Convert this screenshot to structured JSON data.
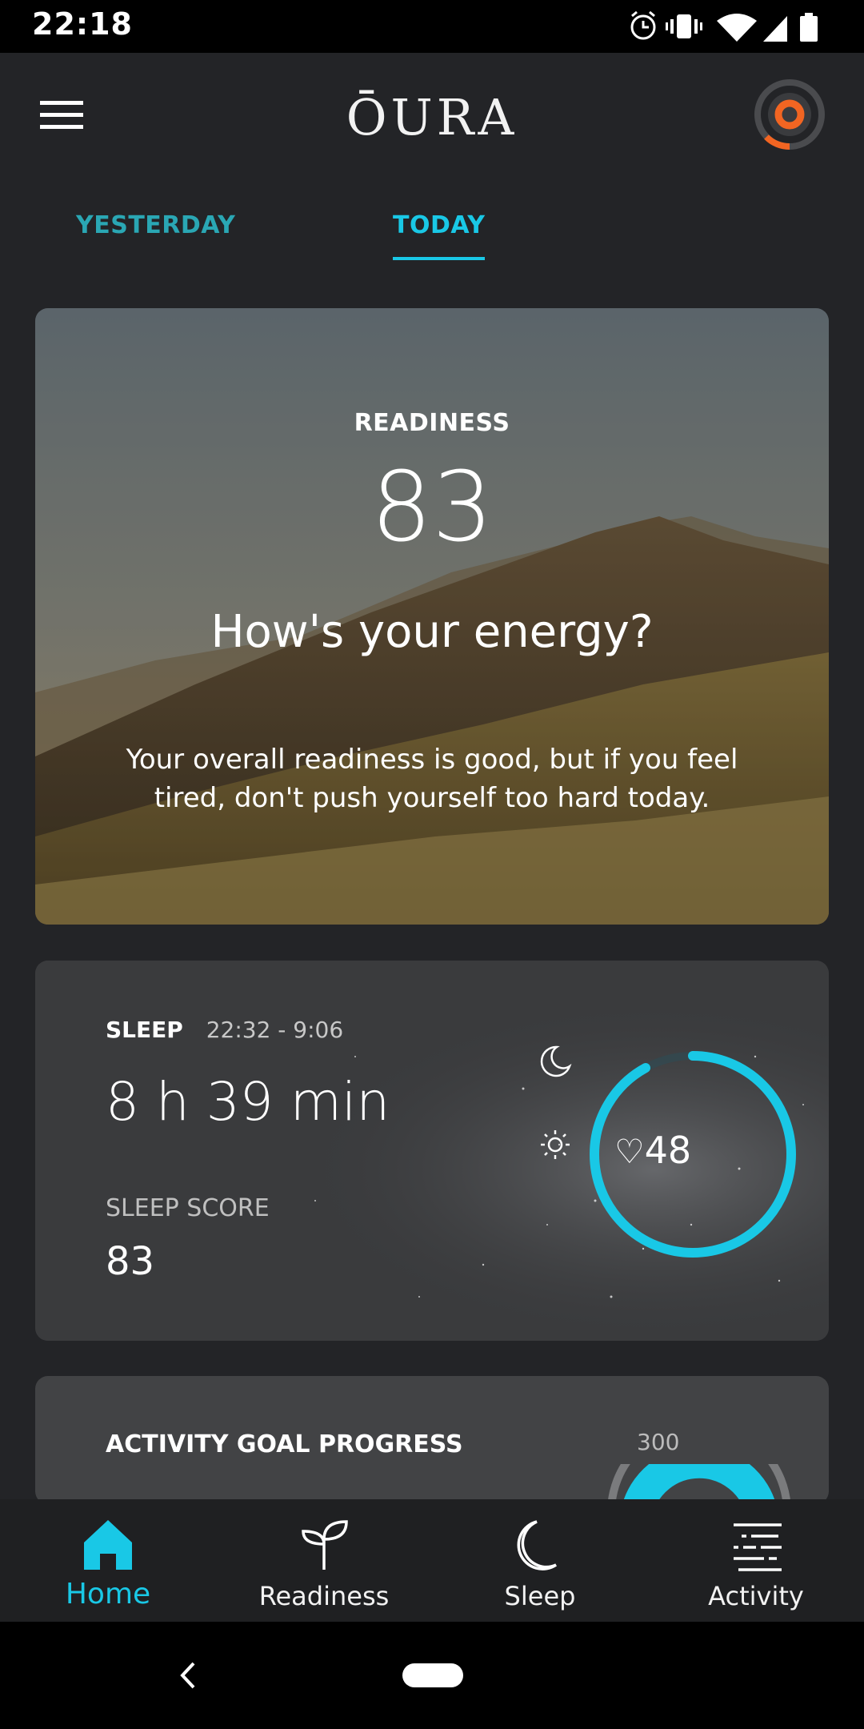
{
  "status_bar": {
    "time": "22:18"
  },
  "app": {
    "brand": "ŌURA"
  },
  "tabs": [
    {
      "label": "YESTERDAY",
      "active": false
    },
    {
      "label": "TODAY",
      "active": true
    }
  ],
  "readiness": {
    "label": "READINESS",
    "score": "83",
    "question": "How's your energy?",
    "message": "Your overall readiness is good, but if you feel tired, don't push yourself too hard today."
  },
  "sleep": {
    "title": "SLEEP",
    "time_range": "22:32 - 9:06",
    "duration": "8 h 39 min",
    "score_label": "SLEEP SCORE",
    "score": "83",
    "heart_rate": "48",
    "ring_fill_fraction": 0.92
  },
  "activity": {
    "title": "ACTIVITY GOAL PROGRESS",
    "target": "300"
  },
  "bottom_nav": [
    {
      "label": "Home",
      "icon": "home-icon",
      "active": true
    },
    {
      "label": "Readiness",
      "icon": "sprout-icon",
      "active": false
    },
    {
      "label": "Sleep",
      "icon": "moon-icon",
      "active": false
    },
    {
      "label": "Activity",
      "icon": "activity-list-icon",
      "active": false
    }
  ],
  "colors": {
    "accent": "#19c8e6",
    "background": "#232427",
    "avatar": "#f26522"
  }
}
